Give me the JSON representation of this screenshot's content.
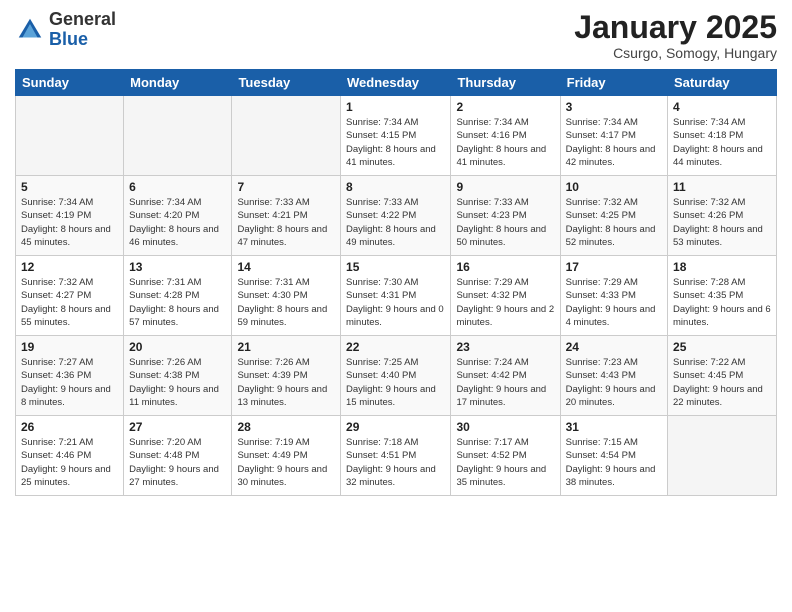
{
  "logo": {
    "general": "General",
    "blue": "Blue"
  },
  "title": "January 2025",
  "subtitle": "Csurgo, Somogy, Hungary",
  "days_header": [
    "Sunday",
    "Monday",
    "Tuesday",
    "Wednesday",
    "Thursday",
    "Friday",
    "Saturday"
  ],
  "weeks": [
    [
      {
        "day": "",
        "info": ""
      },
      {
        "day": "",
        "info": ""
      },
      {
        "day": "",
        "info": ""
      },
      {
        "day": "1",
        "info": "Sunrise: 7:34 AM\nSunset: 4:15 PM\nDaylight: 8 hours and 41 minutes."
      },
      {
        "day": "2",
        "info": "Sunrise: 7:34 AM\nSunset: 4:16 PM\nDaylight: 8 hours and 41 minutes."
      },
      {
        "day": "3",
        "info": "Sunrise: 7:34 AM\nSunset: 4:17 PM\nDaylight: 8 hours and 42 minutes."
      },
      {
        "day": "4",
        "info": "Sunrise: 7:34 AM\nSunset: 4:18 PM\nDaylight: 8 hours and 44 minutes."
      }
    ],
    [
      {
        "day": "5",
        "info": "Sunrise: 7:34 AM\nSunset: 4:19 PM\nDaylight: 8 hours and 45 minutes."
      },
      {
        "day": "6",
        "info": "Sunrise: 7:34 AM\nSunset: 4:20 PM\nDaylight: 8 hours and 46 minutes."
      },
      {
        "day": "7",
        "info": "Sunrise: 7:33 AM\nSunset: 4:21 PM\nDaylight: 8 hours and 47 minutes."
      },
      {
        "day": "8",
        "info": "Sunrise: 7:33 AM\nSunset: 4:22 PM\nDaylight: 8 hours and 49 minutes."
      },
      {
        "day": "9",
        "info": "Sunrise: 7:33 AM\nSunset: 4:23 PM\nDaylight: 8 hours and 50 minutes."
      },
      {
        "day": "10",
        "info": "Sunrise: 7:32 AM\nSunset: 4:25 PM\nDaylight: 8 hours and 52 minutes."
      },
      {
        "day": "11",
        "info": "Sunrise: 7:32 AM\nSunset: 4:26 PM\nDaylight: 8 hours and 53 minutes."
      }
    ],
    [
      {
        "day": "12",
        "info": "Sunrise: 7:32 AM\nSunset: 4:27 PM\nDaylight: 8 hours and 55 minutes."
      },
      {
        "day": "13",
        "info": "Sunrise: 7:31 AM\nSunset: 4:28 PM\nDaylight: 8 hours and 57 minutes."
      },
      {
        "day": "14",
        "info": "Sunrise: 7:31 AM\nSunset: 4:30 PM\nDaylight: 8 hours and 59 minutes."
      },
      {
        "day": "15",
        "info": "Sunrise: 7:30 AM\nSunset: 4:31 PM\nDaylight: 9 hours and 0 minutes."
      },
      {
        "day": "16",
        "info": "Sunrise: 7:29 AM\nSunset: 4:32 PM\nDaylight: 9 hours and 2 minutes."
      },
      {
        "day": "17",
        "info": "Sunrise: 7:29 AM\nSunset: 4:33 PM\nDaylight: 9 hours and 4 minutes."
      },
      {
        "day": "18",
        "info": "Sunrise: 7:28 AM\nSunset: 4:35 PM\nDaylight: 9 hours and 6 minutes."
      }
    ],
    [
      {
        "day": "19",
        "info": "Sunrise: 7:27 AM\nSunset: 4:36 PM\nDaylight: 9 hours and 8 minutes."
      },
      {
        "day": "20",
        "info": "Sunrise: 7:26 AM\nSunset: 4:38 PM\nDaylight: 9 hours and 11 minutes."
      },
      {
        "day": "21",
        "info": "Sunrise: 7:26 AM\nSunset: 4:39 PM\nDaylight: 9 hours and 13 minutes."
      },
      {
        "day": "22",
        "info": "Sunrise: 7:25 AM\nSunset: 4:40 PM\nDaylight: 9 hours and 15 minutes."
      },
      {
        "day": "23",
        "info": "Sunrise: 7:24 AM\nSunset: 4:42 PM\nDaylight: 9 hours and 17 minutes."
      },
      {
        "day": "24",
        "info": "Sunrise: 7:23 AM\nSunset: 4:43 PM\nDaylight: 9 hours and 20 minutes."
      },
      {
        "day": "25",
        "info": "Sunrise: 7:22 AM\nSunset: 4:45 PM\nDaylight: 9 hours and 22 minutes."
      }
    ],
    [
      {
        "day": "26",
        "info": "Sunrise: 7:21 AM\nSunset: 4:46 PM\nDaylight: 9 hours and 25 minutes."
      },
      {
        "day": "27",
        "info": "Sunrise: 7:20 AM\nSunset: 4:48 PM\nDaylight: 9 hours and 27 minutes."
      },
      {
        "day": "28",
        "info": "Sunrise: 7:19 AM\nSunset: 4:49 PM\nDaylight: 9 hours and 30 minutes."
      },
      {
        "day": "29",
        "info": "Sunrise: 7:18 AM\nSunset: 4:51 PM\nDaylight: 9 hours and 32 minutes."
      },
      {
        "day": "30",
        "info": "Sunrise: 7:17 AM\nSunset: 4:52 PM\nDaylight: 9 hours and 35 minutes."
      },
      {
        "day": "31",
        "info": "Sunrise: 7:15 AM\nSunset: 4:54 PM\nDaylight: 9 hours and 38 minutes."
      },
      {
        "day": "",
        "info": ""
      }
    ]
  ]
}
